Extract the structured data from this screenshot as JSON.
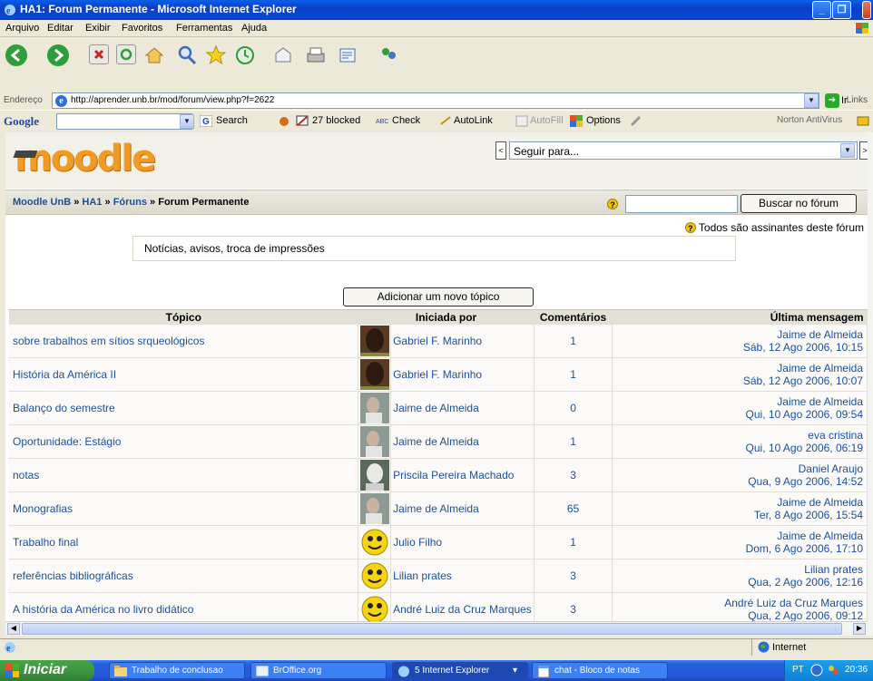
{
  "window": {
    "title": "HA1: Forum Permanente - Microsoft Internet Explorer"
  },
  "menu": [
    "Arquivo",
    "Editar",
    "Exibir",
    "Favoritos",
    "Ferramentas",
    "Ajuda"
  ],
  "address": {
    "label": "Endereço",
    "url": "http://aprender.unb.br/mod/forum/view.php?f=2622",
    "go": "Ir",
    "links": "Links"
  },
  "googlebar": {
    "logo": "Google",
    "search": "Search",
    "blocked": "27 blocked",
    "check": "Check",
    "autolink": "AutoLink",
    "autofill": "AutoFill",
    "options": "Options",
    "norton": "Norton AntiVirus"
  },
  "page": {
    "logo": "moodle",
    "jump_placeholder": "Seguir para...",
    "breadcrumb": {
      "b1": "Moodle UnB",
      "b2": "HA1",
      "b3": "Fóruns",
      "b4": "Forum Permanente"
    },
    "search_button": "Buscar no fórum",
    "subscribe_text": "Todos são assinantes deste fórum",
    "intro": "Notícias, avisos, troca de impressões",
    "add_button": "Adicionar um novo tópico",
    "columns": {
      "topic": "Tópico",
      "started_by": "Iniciada por",
      "comments": "Comentários",
      "last_post": "Última mensagem"
    },
    "rows": [
      {
        "topic": "sobre trabalhos em sítios srqueológicos",
        "author": "Gabriel F. Marinho",
        "count": "1",
        "last_author": "Jaime de Almeida",
        "last_date": "Sáb, 12 Ago 2006, 10:15"
      },
      {
        "topic": "História da América II",
        "author": "Gabriel F. Marinho",
        "count": "1",
        "last_author": "Jaime de Almeida",
        "last_date": "Sáb, 12 Ago 2006, 10:07"
      },
      {
        "topic": "Balanço do semestre",
        "author": "Jaime de Almeida",
        "count": "0",
        "last_author": "Jaime de Almeida",
        "last_date": "Qui, 10 Ago 2006, 09:54"
      },
      {
        "topic": "Oportunidade: Estágio",
        "author": "Jaime de Almeida",
        "count": "1",
        "last_author": "eva cristina",
        "last_date": "Qui, 10 Ago 2006, 06:19"
      },
      {
        "topic": "notas",
        "author": "Priscila Pereira Machado",
        "count": "3",
        "last_author": "Daniel Araujo",
        "last_date": "Qua, 9 Ago 2006, 14:52"
      },
      {
        "topic": "Monografias",
        "author": "Jaime de Almeida",
        "count": "65",
        "last_author": "Jaime de Almeida",
        "last_date": "Ter, 8 Ago 2006, 15:54"
      },
      {
        "topic": "Trabalho final",
        "author": "Julio Filho",
        "count": "1",
        "last_author": "Jaime de Almeida",
        "last_date": "Dom, 6 Ago 2006, 17:10"
      },
      {
        "topic": "referências bibliográficas",
        "author": "Lilian prates",
        "count": "3",
        "last_author": "Lilian prates",
        "last_date": "Qua, 2 Ago 2006, 12:16"
      },
      {
        "topic": "A história da América no livro didático",
        "author": "André Luiz da Cruz Marques",
        "count": "3",
        "last_author": "André Luiz da Cruz Marques",
        "last_date": "Qua, 2 Ago 2006, 09:12"
      }
    ]
  },
  "status": {
    "zone": "Internet"
  },
  "taskbar": {
    "start": "Iniciar",
    "tasks": [
      "Trabalho de conclusao",
      "BrOffice.org",
      "5 Internet Explorer",
      "chat - Bloco de notas"
    ],
    "lang": "PT",
    "time": "20:36"
  },
  "colors": {
    "link": "#1b4f9c",
    "logo": "#f29a21",
    "titlebar": "#0a4fdc",
    "taskbar": "#245edb",
    "start": "#388e3c"
  }
}
